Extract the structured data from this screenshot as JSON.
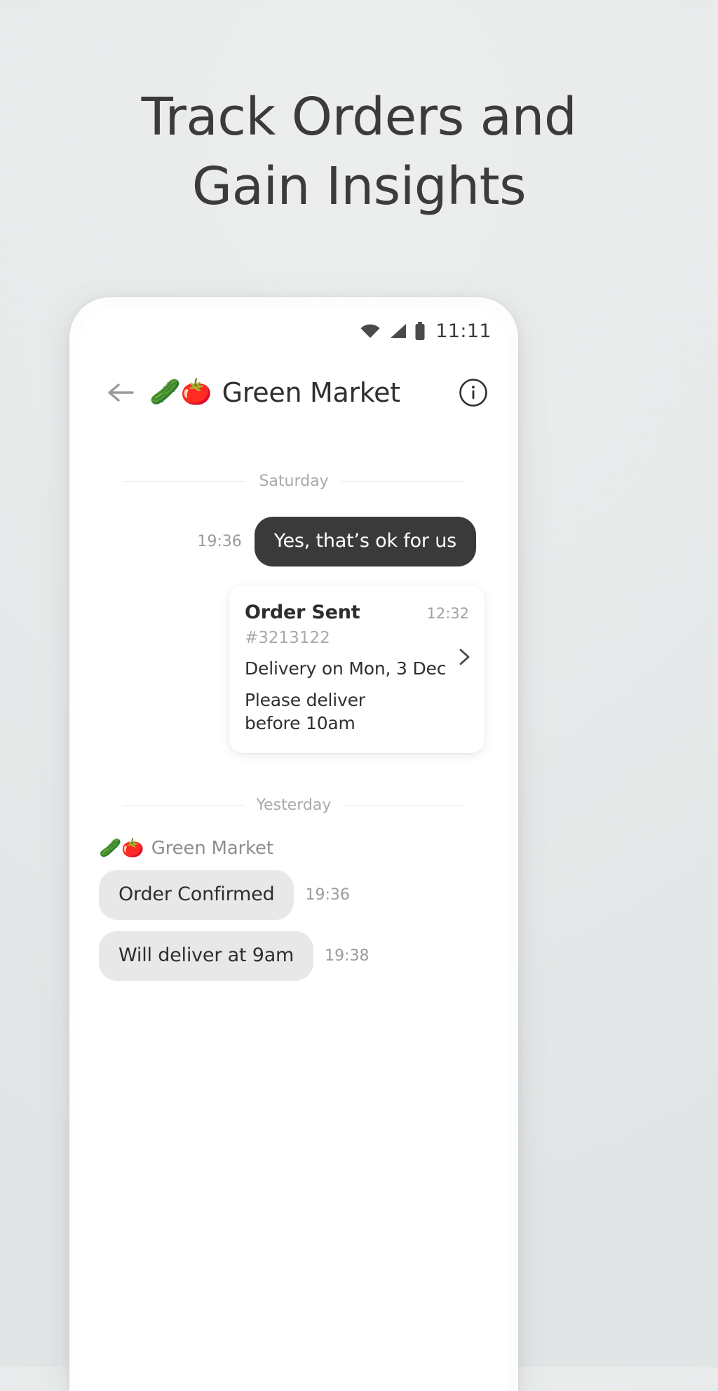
{
  "promo": {
    "headline_line1": "Track Orders and",
    "headline_line2": "Gain Insights"
  },
  "status_bar": {
    "wifi_icon": "wifi-icon",
    "signal_icon": "cellular-signal-icon",
    "battery_icon": "battery-full-icon",
    "time": "11:11"
  },
  "header": {
    "back_icon": "back-arrow-icon",
    "avatar_emoji": "🥒🍅",
    "title": "Green Market",
    "info_icon": "info-icon"
  },
  "chat": {
    "dividers": {
      "saturday": "Saturday",
      "yesterday": "Yesterday"
    },
    "outgoing_message": {
      "text": "Yes, that’s ok for us",
      "time": "19:36"
    },
    "order_card": {
      "title": "Order Sent",
      "time": "12:32",
      "order_number": "#3213122",
      "delivery": "Delivery on Mon, 3 Dec",
      "note": "Please deliver before 10am",
      "chevron_icon": "chevron-right-icon"
    },
    "sender": {
      "emoji": "🥒🍅",
      "name": "Green Market"
    },
    "incoming_messages": [
      {
        "text": "Order Confirmed",
        "time": "19:36"
      },
      {
        "text": "Will deliver at 9am",
        "time": "19:38"
      }
    ]
  },
  "colors": {
    "page_background": "#eaecec",
    "headline_text": "#3b3b3b",
    "bubble_outgoing": "#3a3a3a",
    "bubble_incoming": "#e8e8e8",
    "timestamp_text": "#9b9b9b",
    "muted_text": "#a8a8a8"
  }
}
